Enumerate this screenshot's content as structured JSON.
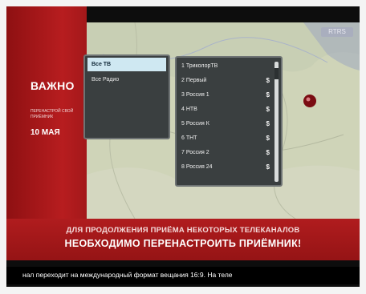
{
  "colors": {
    "banner_red": "#b71d1f",
    "menu_bg": "#3a3f40",
    "selected_category_bg": "#cfe8f2",
    "map_green": "#cfd4b8",
    "ticker_bg": "#000000"
  },
  "left_banner": {
    "title": "ВАЖНО",
    "small_text": "ПЕРЕНАСТРОЙ СВОЙ ПРИЁМНИК",
    "date": "10 МАЯ"
  },
  "map": {
    "chip_label": "RTRS"
  },
  "category_menu": {
    "items": [
      {
        "label": "Все ТВ",
        "selected": true
      },
      {
        "label": "Все Радио",
        "selected": false
      }
    ]
  },
  "channel_menu": {
    "items": [
      {
        "label": "1 ТриколорТВ",
        "badge": ""
      },
      {
        "label": "2 Первый",
        "badge": "$"
      },
      {
        "label": "3 Россия 1",
        "badge": "$"
      },
      {
        "label": "4 НТВ",
        "badge": "$"
      },
      {
        "label": "5 Россия К",
        "badge": "$"
      },
      {
        "label": "6 ТНТ",
        "badge": "$"
      },
      {
        "label": "7 Россия 2",
        "badge": "$"
      },
      {
        "label": "8 Россия 24",
        "badge": "$"
      }
    ]
  },
  "ribbon": {
    "line1": "ДЛЯ ПРОДОЛЖЕНИЯ ПРИЁМА НЕКОТОРЫХ ТЕЛЕКАНАЛОВ",
    "line2": "НЕОБХОДИМО ПЕРЕНАСТРОИТЬ ПРИЁМНИК!"
  },
  "ticker": {
    "text": "нал переходит на международный формат вещания 16:9. На теле"
  }
}
